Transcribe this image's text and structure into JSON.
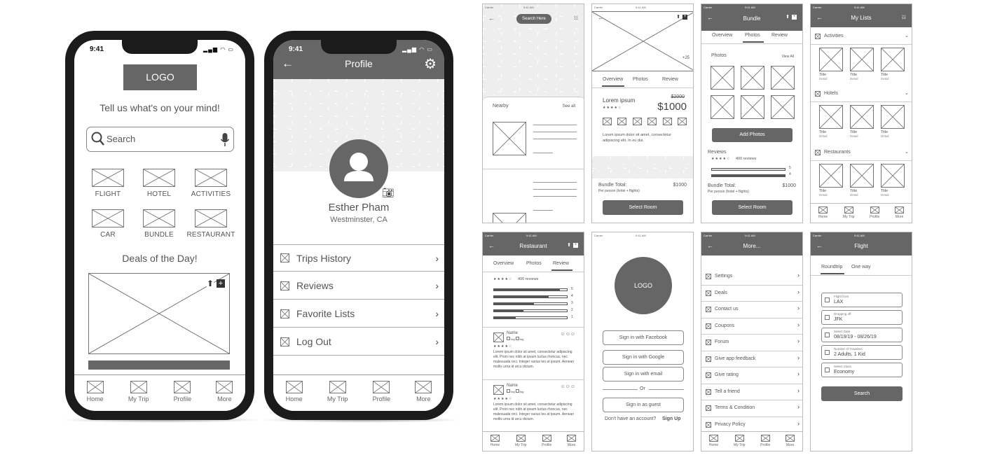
{
  "status_time": "9:41",
  "status_small": {
    "carrier": "Carrier",
    "time": "9:41 AM"
  },
  "tabbar": [
    "Home",
    "My Trip",
    "Profile",
    "More"
  ],
  "home": {
    "logo": "LOGO",
    "prompt": "Tell us what's on your mind!",
    "search_placeholder": "Search",
    "categories": [
      "FLIGHT",
      "HOTEL",
      "ACTIVITIES",
      "CAR",
      "BUNDLE",
      "RESTAURANT"
    ],
    "deals_title": "Deals of the Day!"
  },
  "profile": {
    "title": "Profile",
    "name": "Esther Pham",
    "location": "Westminster, CA",
    "menu": [
      "Trips History",
      "Reviews",
      "Favorite Lists",
      "Log Out"
    ]
  },
  "map_screen": {
    "search_here": "Search Here",
    "nearby": "Nearby",
    "see_all": "See all"
  },
  "detail_screen": {
    "photo_count": "+25",
    "tabs": [
      "Overview",
      "Photos",
      "Review"
    ],
    "item_title": "Lorem ipsum",
    "old_price": "$2000",
    "price": "$1000",
    "description": "Lorem ipsum dolor sit amet, consectetur adipiscing elit. In eu dui.",
    "bundle_total": "Bundle Total:",
    "bundle_total_value": "$1000",
    "per_person": "Per person (hotel + flights)",
    "select_room": "Select Room"
  },
  "bundle_screen": {
    "title": "Bundle",
    "tabs": [
      "Overview",
      "Photos",
      "Review"
    ],
    "photos": "Photos",
    "view_all": "View All",
    "add_photos": "Add Photos",
    "reviews": "Reviews",
    "reviews_count": "400 reviews",
    "bundle_total": "Bundle Total:",
    "bundle_total_value": "$1000",
    "per_person": "Per person (hotel + flights)",
    "select_room": "Select Room"
  },
  "lists_screen": {
    "title": "My Lists",
    "sections": [
      "Activities",
      "Hotels",
      "Restaurants"
    ],
    "item_title": "Title",
    "item_detail": "Detail"
  },
  "restaurant_screen": {
    "title": "Restaurant",
    "tabs": [
      "Overview",
      "Photos",
      "Review"
    ],
    "reviews_count": "400 reviews",
    "rating_levels": [
      "5",
      "4",
      "3",
      "2",
      "1"
    ],
    "rating_fill": [
      0.9,
      0.75,
      0.55,
      0.4,
      0.3
    ],
    "review_name": "Name",
    "review_meta": "tag",
    "review_text": "Lorem ipsum dolor sit amet, consectetur adipiscing elit. Proin nec nibh at ipsum luctus rhoncus, nec malesuada orci. Integer varius leo at ipsum. Aenean mollis urna id arcu dictum."
  },
  "login_screen": {
    "logo": "LOGO",
    "facebook": "Sign in with Facebook",
    "google": "Sign in with Google",
    "email": "Sign in with email",
    "or": "Or",
    "guest": "Sign in as guest",
    "no_account": "Don't have an account?",
    "sign_up": "Sign Up"
  },
  "more_screen": {
    "title": "More...",
    "items": [
      "Settings",
      "Deals",
      "Contact us",
      "Coupons",
      "Forum",
      "Give app feedback",
      "Give rating",
      "Tell a friend",
      "Terms & Condition",
      "Privacy Policy"
    ]
  },
  "flight_screen": {
    "title": "Flight",
    "tabs": [
      "Roundtrip",
      "One way"
    ],
    "fields": [
      {
        "label": "Flight from",
        "value": "LAX"
      },
      {
        "label": "Dropping off",
        "value": "JFK"
      },
      {
        "label": "Select Date",
        "value": "08/19/19 - 08/26/19"
      },
      {
        "label": "Number of Travelers",
        "value": "2 Adults, 1 Kid"
      },
      {
        "label": "Select Class",
        "value": "Economy"
      }
    ],
    "search": "Search"
  },
  "colors": {
    "accent": "#666666",
    "frame": "#1b1b1b",
    "line": "#999999"
  }
}
